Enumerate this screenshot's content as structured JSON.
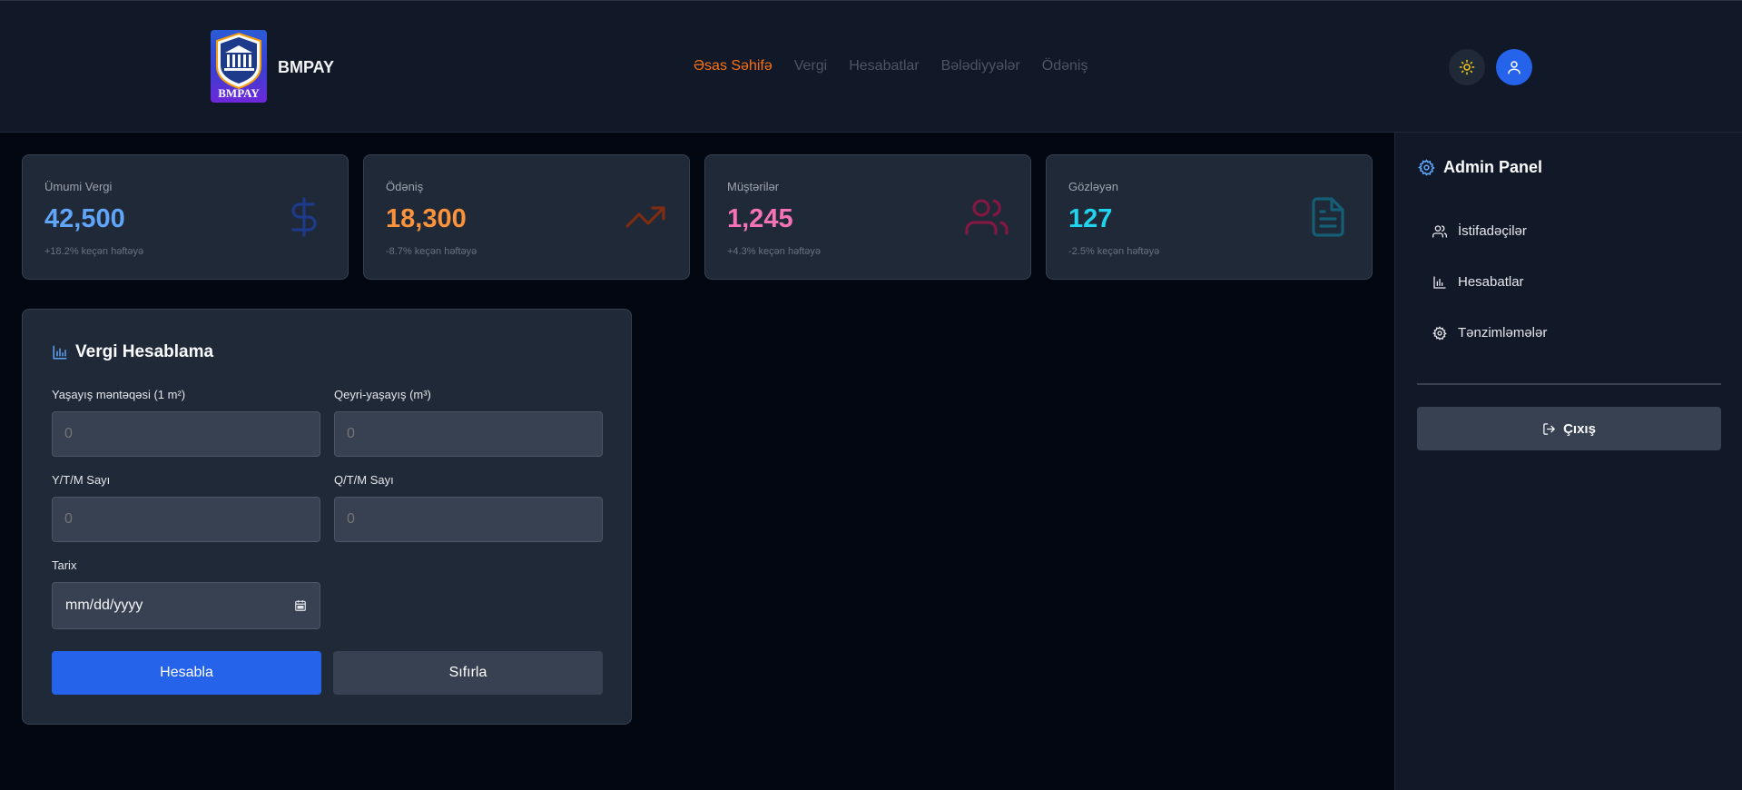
{
  "header": {
    "logo_text": "BMPAY",
    "brand": "BMPAY",
    "nav": [
      {
        "label": "Əsas Səhifə",
        "active": true
      },
      {
        "label": "Vergi",
        "active": false
      },
      {
        "label": "Hesabatlar",
        "active": false
      },
      {
        "label": "Bələdiyyələr",
        "active": false
      },
      {
        "label": "Ödəniş",
        "active": false
      }
    ],
    "theme_icon": "sun-icon",
    "user_icon": "user-icon"
  },
  "stats": [
    {
      "label": "Ümumi Vergi",
      "value": "42,500",
      "change": "+18.2% keçən həftəyə",
      "color": "#60a5fa",
      "icon": "dollar-icon",
      "icon_color": "#1e3a8a"
    },
    {
      "label": "Ödəniş",
      "value": "18,300",
      "change": "-8.7% keçən həftəyə",
      "color": "#fb923c",
      "icon": "trending-up-icon",
      "icon_color": "#7c2d12"
    },
    {
      "label": "Müştərilər",
      "value": "1,245",
      "change": "+4.3% keçən həftəyə",
      "color": "#f472b6",
      "icon": "users-icon",
      "icon_color": "#831843"
    },
    {
      "label": "Gözləyən",
      "value": "127",
      "change": "-2.5% keçən həftəyə",
      "color": "#22d3ee",
      "icon": "file-text-icon",
      "icon_color": "#155e75"
    }
  ],
  "calculator": {
    "title": "Vergi Hesablama",
    "fields": {
      "residential": {
        "label": "Yaşayış məntəqəsi (1 m²)",
        "value": "0"
      },
      "nonresidential": {
        "label": "Qeyri-yaşayış (m³)",
        "value": "0"
      },
      "ytm": {
        "label": "Y/T/M Sayı",
        "value": "0"
      },
      "qtm": {
        "label": "Q/T/M Sayı",
        "value": "0"
      },
      "date": {
        "label": "Tarix",
        "placeholder": "mm/dd/yyyy"
      }
    },
    "calculate_label": "Hesabla",
    "reset_label": "Sıfırla"
  },
  "sidebar": {
    "title": "Admin Panel",
    "items": [
      {
        "label": "İstifadəçilər",
        "icon": "users-icon"
      },
      {
        "label": "Hesabatlar",
        "icon": "bar-chart-icon"
      },
      {
        "label": "Tənzimləmələr",
        "icon": "settings-icon"
      }
    ],
    "logout_label": "Çıxış"
  },
  "colors": {
    "accent": "#2563eb",
    "nav_active": "#f97316",
    "panel": "#1f2937",
    "background": "#030712"
  }
}
